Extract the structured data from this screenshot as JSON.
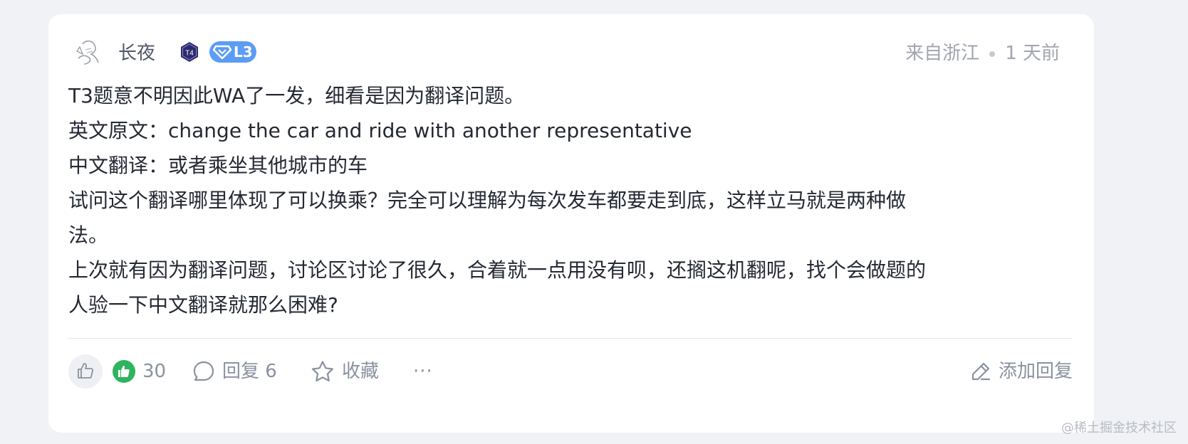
{
  "author": {
    "name": "长夜",
    "hex_badge_text": "T4",
    "level_badge": "L3"
  },
  "meta": {
    "location": "来自浙江",
    "time": "1 天前"
  },
  "comment": {
    "lines": [
      "T3题意不明因此WA了一发，细看是因为翻译问题。",
      "英文原文：change the car and ride with another representative",
      "中文翻译：或者乘坐其他城市的车",
      "试问这个翻译哪里体现了可以换乘？完全可以理解为每次发车都要走到底，这样立马就是两种做",
      "法。",
      "上次就有因为翻译问题，讨论区讨论了很久，合着就一点用没有呗，还搁这机翻呢，找个会做题的",
      "人验一下中文翻译就那么困难?"
    ]
  },
  "actions": {
    "like_count": "30",
    "reply_label": "回复 6",
    "favorite_label": "收藏",
    "more_label": "···",
    "add_reply_label": "添加回复"
  },
  "watermark": "@稀土掘金技术社区",
  "colors": {
    "accent_green": "#2fb45f",
    "badge_blue": "#5b9cf5",
    "badge_navy": "#2b2a6e"
  }
}
